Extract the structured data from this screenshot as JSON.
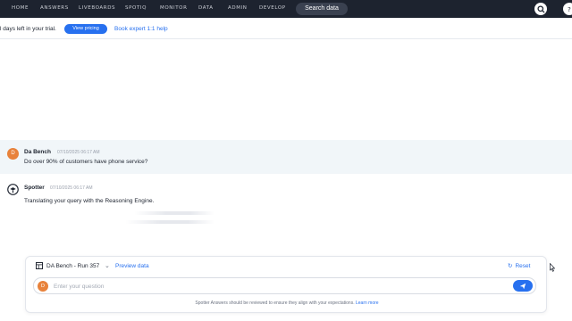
{
  "nav": {
    "items": [
      "HOME",
      "ANSWERS",
      "LIVEBOARDS",
      "SPOTIQ",
      "MONITOR",
      "DATA",
      "ADMIN",
      "DEVELOP"
    ],
    "search_label": "Search data",
    "icons": [
      "search-icon",
      "help-icon"
    ]
  },
  "trial": {
    "text": "l days left in your trial.",
    "pricing_label": "View pricing",
    "expert_label": "Book expert 1:1 help"
  },
  "conversation": {
    "user_message": {
      "avatar_initial": "D",
      "name": "Da Bench",
      "timestamp": "07/10/2025 06:17 AM",
      "text": "Do over 90% of customers have phone service?"
    },
    "spotter_message": {
      "name": "Spotter",
      "timestamp": "07/10/2025 06:17 AM",
      "text": "Translating your query with the Reasoning Engine."
    }
  },
  "composer": {
    "datasource_label": "DA Bench - Run 357",
    "preview_label": "Preview data",
    "reset_label": "Reset",
    "avatar_initial": "D",
    "input_value": "",
    "input_placeholder": "Enter your question",
    "disclaimer": "Spotter Answers should be reviewed to ensure they align with your expectations.",
    "learn_more": "Learn more"
  },
  "colors": {
    "nav_bg": "#1d232f",
    "accent": "#2770ef",
    "avatar": "#e8823b",
    "user_msg_bg": "#f1f6f9"
  }
}
